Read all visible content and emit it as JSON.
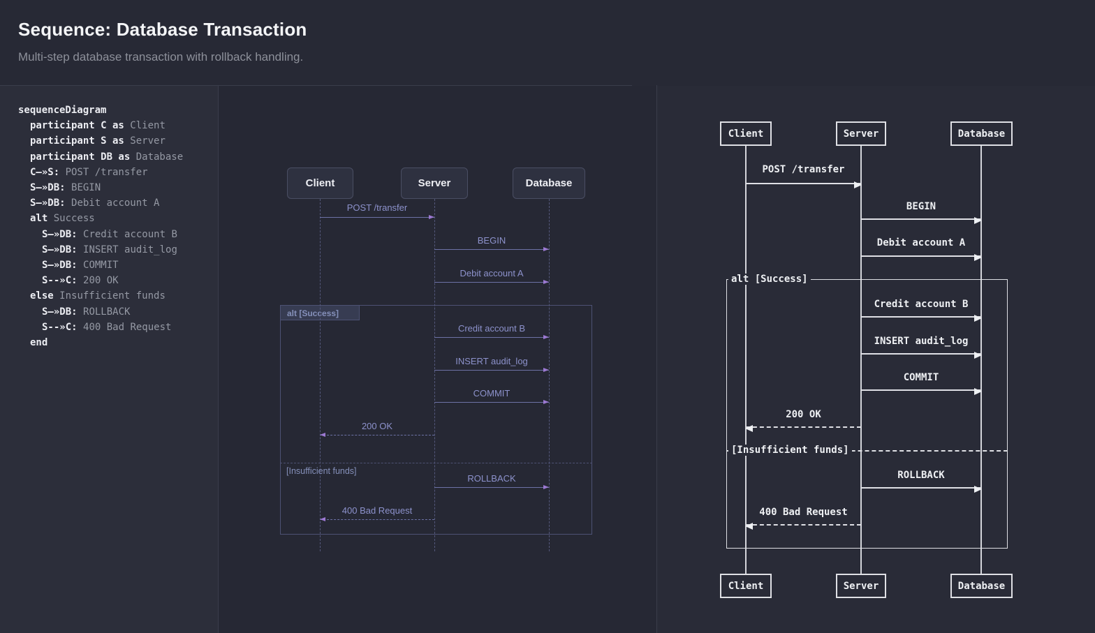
{
  "header": {
    "title": "Sequence: Database Transaction",
    "subtitle": "Multi-step database transaction with rollback handling."
  },
  "code": {
    "lines": [
      {
        "ind": 0,
        "tokens": [
          [
            "k",
            "sequenceDiagram"
          ]
        ]
      },
      {
        "ind": 1,
        "tokens": [
          [
            "k",
            "participant C as "
          ],
          [
            "p",
            "Client"
          ]
        ]
      },
      {
        "ind": 1,
        "tokens": [
          [
            "k",
            "participant S as "
          ],
          [
            "p",
            "Server"
          ]
        ]
      },
      {
        "ind": 1,
        "tokens": [
          [
            "k",
            "participant DB as "
          ],
          [
            "p",
            "Database"
          ]
        ]
      },
      {
        "ind": 1,
        "tokens": [
          [
            "k",
            "C—»S: "
          ],
          [
            "p",
            "POST /transfer"
          ]
        ]
      },
      {
        "ind": 1,
        "tokens": [
          [
            "k",
            "S—»DB: "
          ],
          [
            "p",
            "BEGIN"
          ]
        ]
      },
      {
        "ind": 1,
        "tokens": [
          [
            "k",
            "S—»DB: "
          ],
          [
            "p",
            "Debit account A"
          ]
        ]
      },
      {
        "ind": 1,
        "tokens": [
          [
            "k",
            "alt "
          ],
          [
            "p",
            "Success"
          ]
        ]
      },
      {
        "ind": 2,
        "tokens": [
          [
            "k",
            "S—»DB: "
          ],
          [
            "p",
            "Credit account B"
          ]
        ]
      },
      {
        "ind": 2,
        "tokens": [
          [
            "k",
            "S—»DB: "
          ],
          [
            "p",
            "INSERT audit_log"
          ]
        ]
      },
      {
        "ind": 2,
        "tokens": [
          [
            "k",
            "S—»DB: "
          ],
          [
            "p",
            "COMMIT"
          ]
        ]
      },
      {
        "ind": 2,
        "tokens": [
          [
            "k",
            "S--»C: "
          ],
          [
            "p",
            "200 OK"
          ]
        ]
      },
      {
        "ind": 1,
        "tokens": [
          [
            "k",
            "else "
          ],
          [
            "p",
            "Insufficient funds"
          ]
        ]
      },
      {
        "ind": 2,
        "tokens": [
          [
            "k",
            "S—»DB: "
          ],
          [
            "p",
            "ROLLBACK"
          ]
        ]
      },
      {
        "ind": 2,
        "tokens": [
          [
            "k",
            "S--»C: "
          ],
          [
            "p",
            "400 Bad Request"
          ]
        ]
      },
      {
        "ind": 1,
        "tokens": [
          [
            "k",
            "end"
          ]
        ]
      }
    ]
  },
  "diagram": {
    "actors": [
      "Client",
      "Server",
      "Database"
    ],
    "alt_label": "alt [Success]",
    "else_label": "[Insufficient funds]",
    "messages": [
      {
        "label": "POST /transfer",
        "from": "Client",
        "to": "Server",
        "type": "solid"
      },
      {
        "label": "BEGIN",
        "from": "Server",
        "to": "Database",
        "type": "solid"
      },
      {
        "label": "Debit account A",
        "from": "Server",
        "to": "Database",
        "type": "solid"
      },
      {
        "label": "Credit account B",
        "from": "Server",
        "to": "Database",
        "type": "solid"
      },
      {
        "label": "INSERT audit_log",
        "from": "Server",
        "to": "Database",
        "type": "solid"
      },
      {
        "label": "COMMIT",
        "from": "Server",
        "to": "Database",
        "type": "solid"
      },
      {
        "label": "200 OK",
        "from": "Server",
        "to": "Client",
        "type": "dashed"
      },
      {
        "label": "ROLLBACK",
        "from": "Server",
        "to": "Database",
        "type": "solid"
      },
      {
        "label": "400 Bad Request",
        "from": "Server",
        "to": "Client",
        "type": "dashed"
      }
    ]
  },
  "colors": {
    "message_text_lavender": "#8d92cc",
    "arrow_line_purple": "#6d72a6",
    "arrowhead_purple": "#9c79d2",
    "frame_slate": "#4d5274",
    "ascii_white": "#eef0f3",
    "code_keyword": "#ecedf2",
    "code_plain": "#9599a4",
    "bg_dark": "#262834"
  }
}
